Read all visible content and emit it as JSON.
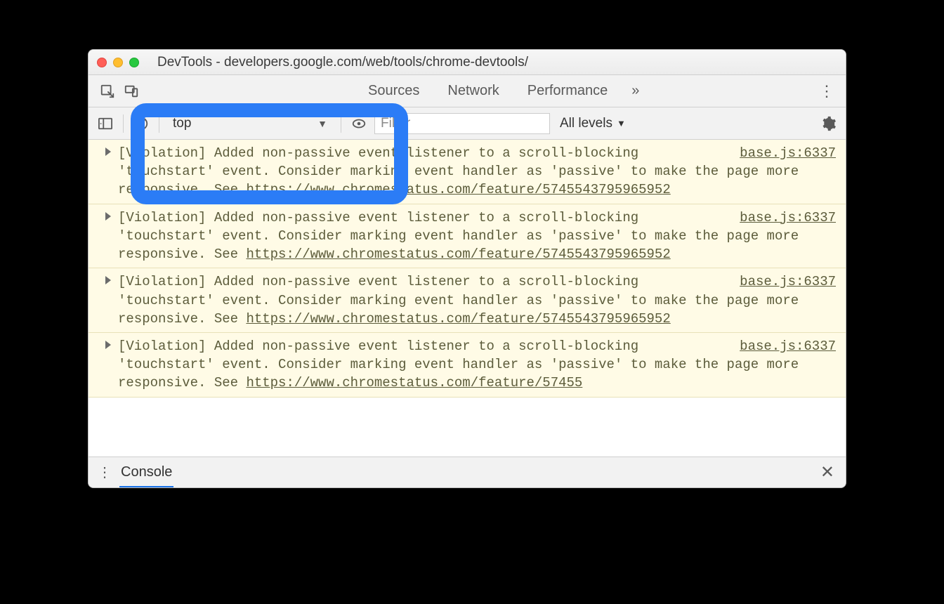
{
  "window": {
    "title": "DevTools - developers.google.com/web/tools/chrome-devtools/"
  },
  "tabs": {
    "sources": "Sources",
    "network": "Network",
    "performance": "Performance",
    "more_glyph": "»"
  },
  "toolbar": {
    "context": "top",
    "filter_placeholder": "Filter",
    "levels_label": "All levels"
  },
  "messages": [
    {
      "prefix": "[Violation]",
      "text_a": " Added non-passive event listener to a scroll-blocking 'touchstart' event. Consider marking event handler as 'passive' to make the page more responsive. See ",
      "link": "https://www.chromestatus.com/feature/5745543795965952",
      "source": "base.js:6337"
    },
    {
      "prefix": "[Violation]",
      "text_a": " Added non-passive event listener to a scroll-blocking 'touchstart' event. Consider marking event handler as 'passive' to make the page more responsive. See ",
      "link": "https://www.chromestatus.com/feature/5745543795965952",
      "source": "base.js:6337"
    },
    {
      "prefix": "[Violation]",
      "text_a": " Added non-passive event listener to a scroll-blocking 'touchstart' event. Consider marking event handler as 'passive' to make the page more responsive. See ",
      "link": "https://www.chromestatus.com/feature/5745543795965952",
      "source": "base.js:6337"
    },
    {
      "prefix": "[Violation]",
      "text_a": " Added non-passive event listener to a scroll-blocking 'touchstart' event. Consider marking event handler as 'passive' to make the page more responsive. See ",
      "link": "https://www.chromestatus.com/feature/57455",
      "source": "base.js:6337"
    }
  ],
  "drawer": {
    "tab": "Console"
  }
}
